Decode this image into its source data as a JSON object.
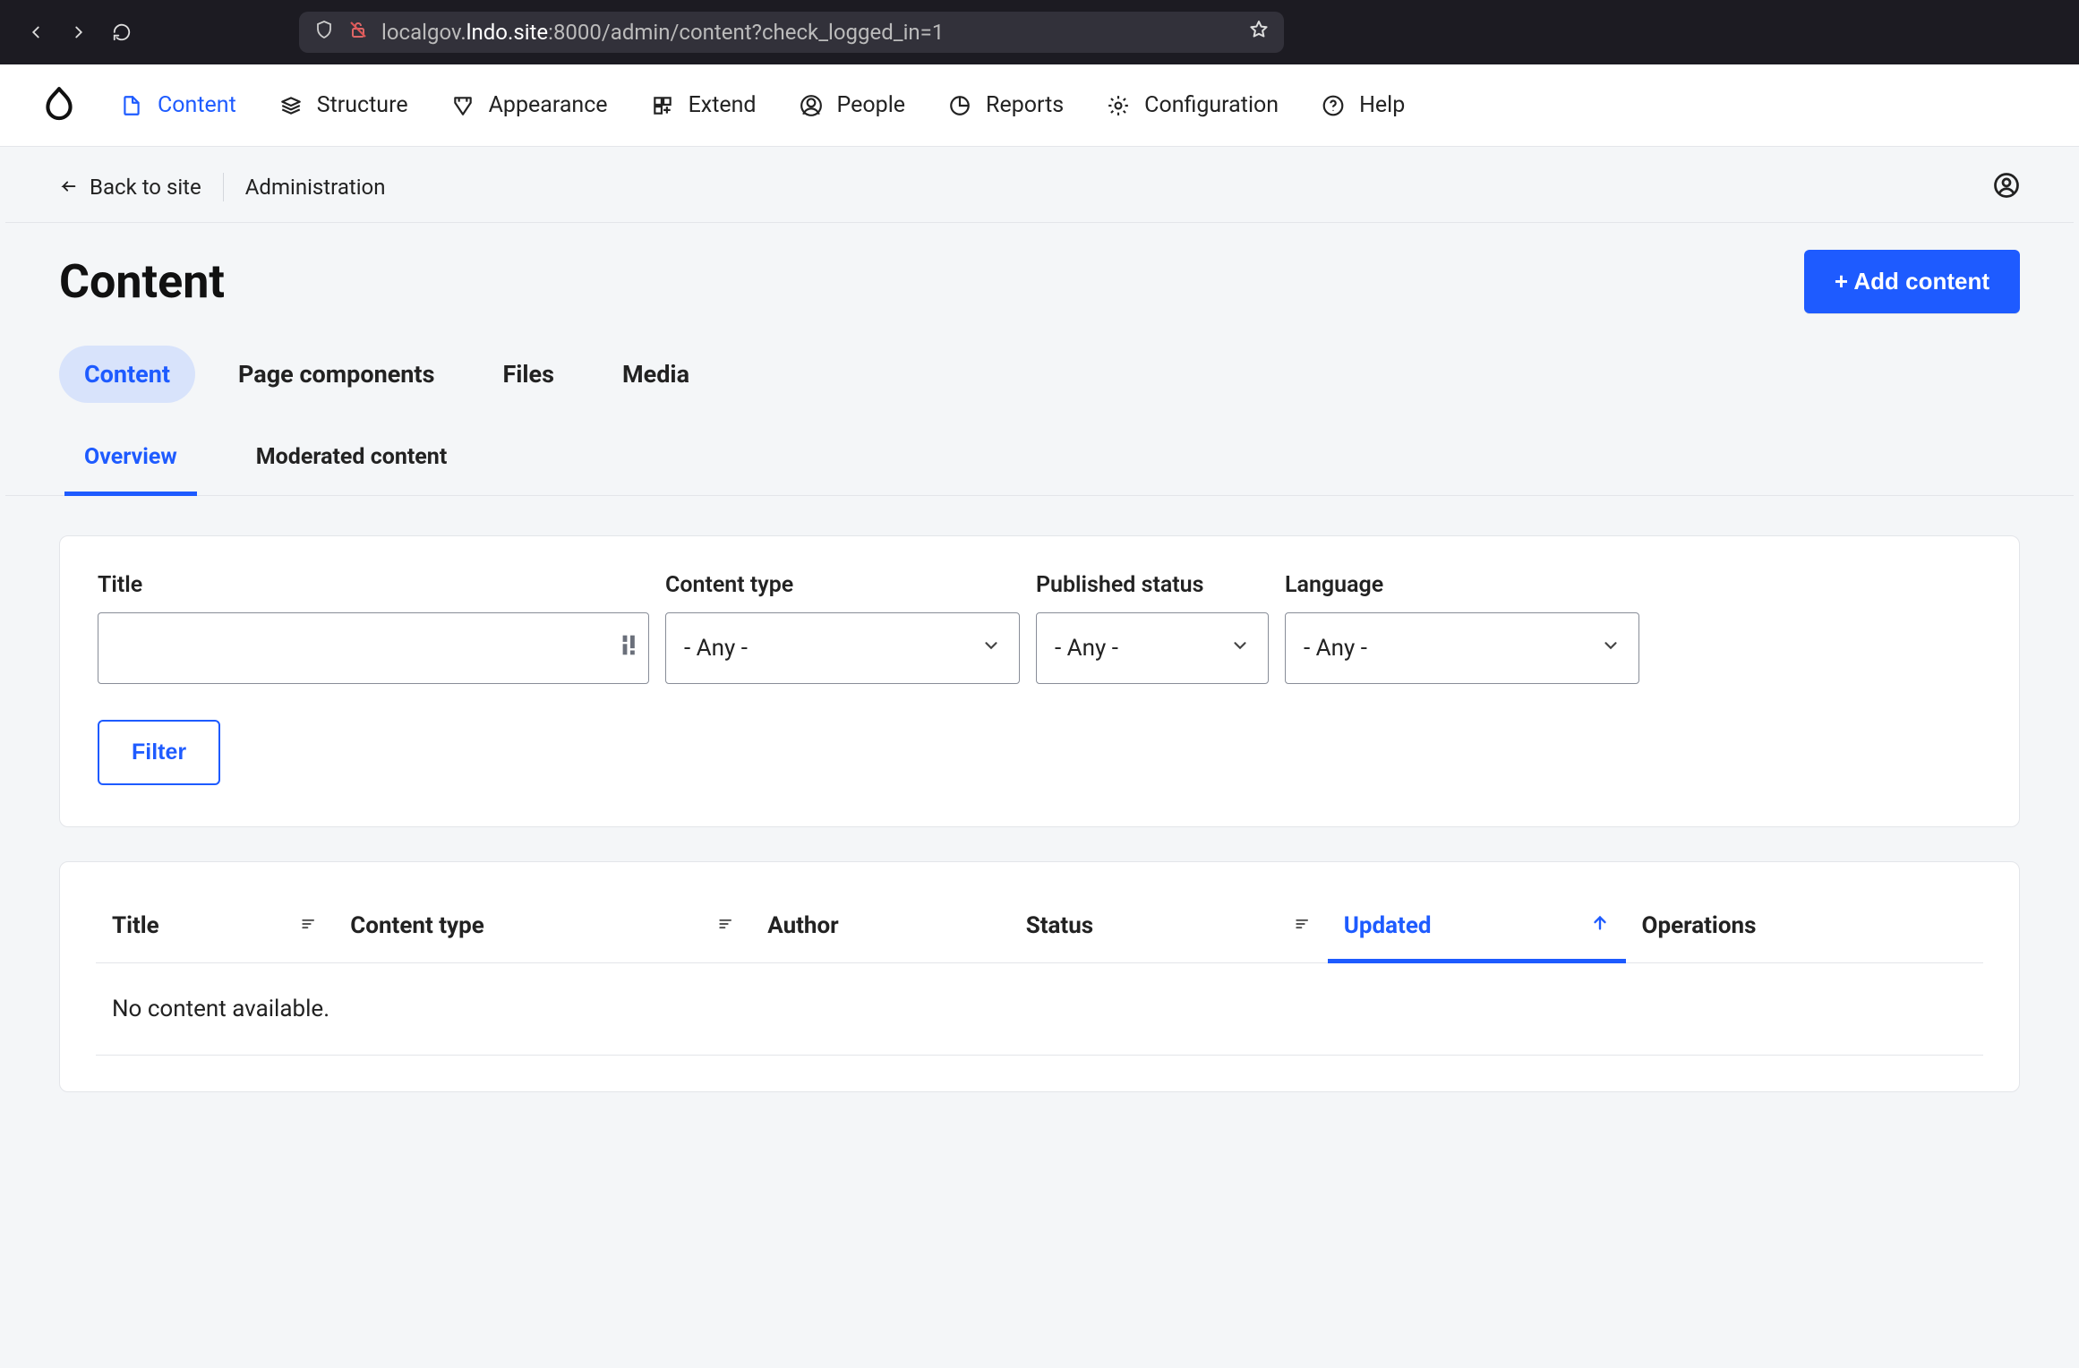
{
  "browser": {
    "url_pre": "localgov.",
    "url_host": "lndo.site",
    "url_rest": ":8000/admin/content?check_logged_in=1"
  },
  "toolbar": {
    "items": [
      {
        "label": "Content"
      },
      {
        "label": "Structure"
      },
      {
        "label": "Appearance"
      },
      {
        "label": "Extend"
      },
      {
        "label": "People"
      },
      {
        "label": "Reports"
      },
      {
        "label": "Configuration"
      },
      {
        "label": "Help"
      }
    ]
  },
  "breadcrumb": {
    "back": "Back to site",
    "items": [
      "Administration"
    ]
  },
  "page": {
    "title": "Content",
    "add_button": "+ Add content"
  },
  "primary_tabs": {
    "items": [
      {
        "label": "Content"
      },
      {
        "label": "Page components"
      },
      {
        "label": "Files"
      },
      {
        "label": "Media"
      }
    ]
  },
  "secondary_tabs": {
    "items": [
      {
        "label": "Overview"
      },
      {
        "label": "Moderated content"
      }
    ]
  },
  "filters": {
    "title_label": "Title",
    "title_value": "",
    "content_type_label": "Content type",
    "content_type_value": "- Any -",
    "status_label": "Published status",
    "status_value": "- Any -",
    "language_label": "Language",
    "language_value": "- Any -",
    "filter_button": "Filter"
  },
  "table": {
    "columns": {
      "title": "Title",
      "content_type": "Content type",
      "author": "Author",
      "status": "Status",
      "updated": "Updated",
      "operations": "Operations"
    },
    "empty": "No content available."
  }
}
